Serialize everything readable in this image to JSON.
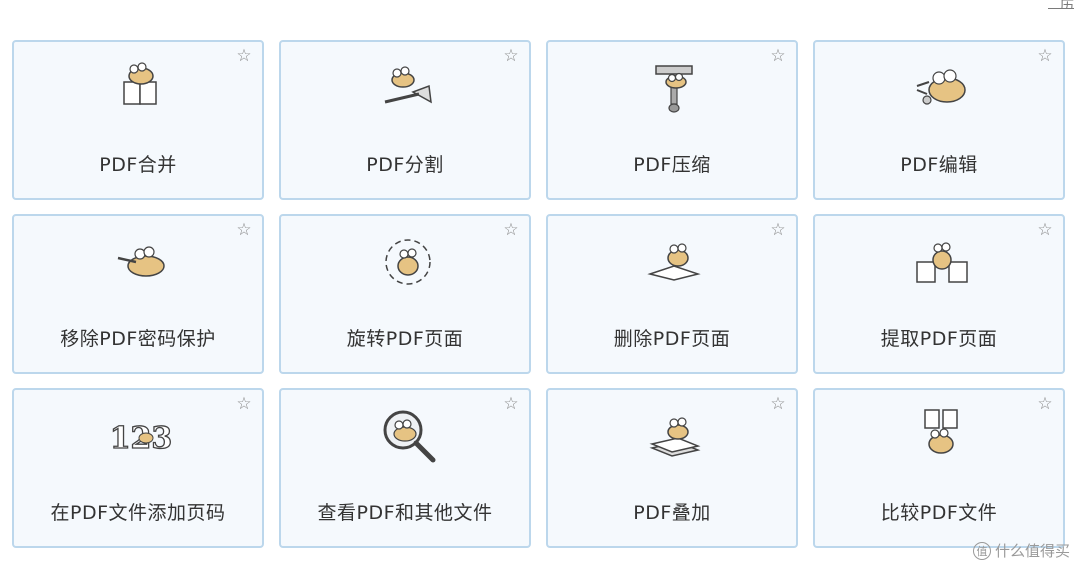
{
  "corner_fragment": "历",
  "cards": [
    {
      "label": "PDF合并",
      "icon": "merge-pages-icon"
    },
    {
      "label": "PDF分割",
      "icon": "split-axe-icon"
    },
    {
      "label": "PDF压缩",
      "icon": "compress-clamp-icon"
    },
    {
      "label": "PDF编辑",
      "icon": "edit-wrench-icon"
    },
    {
      "label": "移除PDF密码保护",
      "icon": "remove-password-icon"
    },
    {
      "label": "旋转PDF页面",
      "icon": "rotate-page-icon"
    },
    {
      "label": "删除PDF页面",
      "icon": "delete-page-icon"
    },
    {
      "label": "提取PDF页面",
      "icon": "extract-page-icon"
    },
    {
      "label": "在PDF文件添加页码",
      "icon": "page-number-icon"
    },
    {
      "label": "查看PDF和其他文件",
      "icon": "view-magnifier-icon"
    },
    {
      "label": "PDF叠加",
      "icon": "overlay-pages-icon"
    },
    {
      "label": "比较PDF文件",
      "icon": "compare-files-icon"
    }
  ],
  "star_symbol": "☆",
  "watermark": {
    "text": "什么值得买",
    "icon_glyph": "值"
  },
  "colors": {
    "card_bg": "#f5f9fd",
    "card_border": "#bcd7ec",
    "mascot_fill": "#e6c383"
  }
}
